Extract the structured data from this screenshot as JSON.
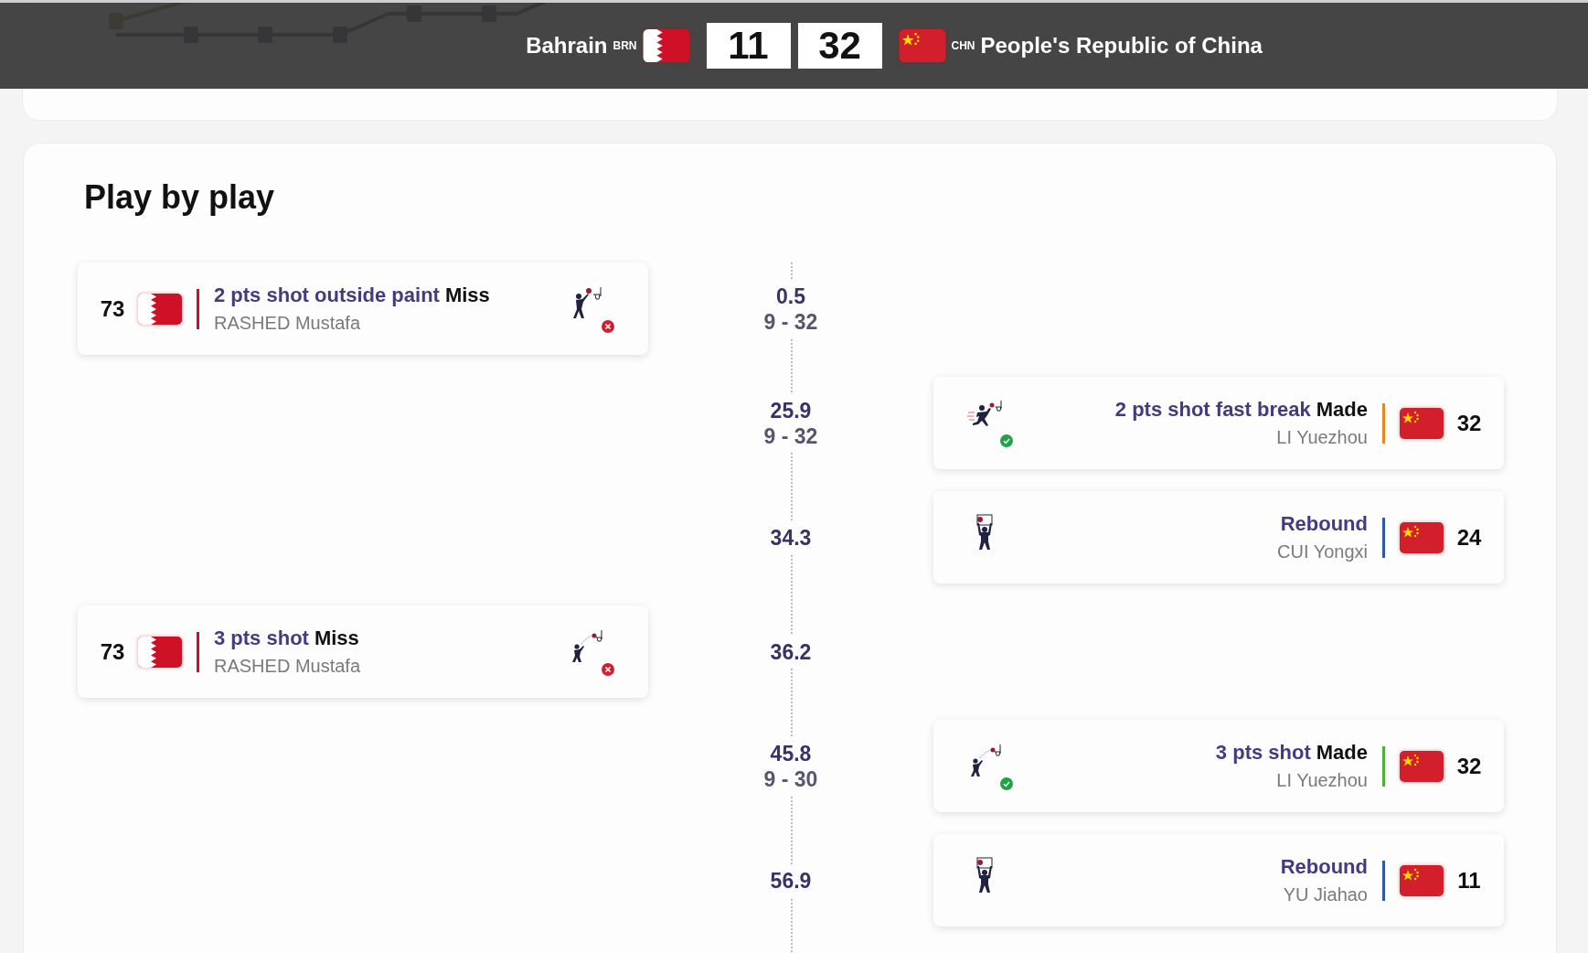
{
  "header": {
    "teams": [
      {
        "name": "Bahrain",
        "code": "BRN",
        "score": "11"
      },
      {
        "name": "People's Republic of China",
        "code": "CHN",
        "score": "32"
      }
    ]
  },
  "play_by_play": {
    "title": "Play by play",
    "events": [
      {
        "time": "0.5",
        "score": "9 - 32",
        "home": {
          "number": "73",
          "color": "#c8102e",
          "action": "2 pts shot outside paint",
          "result": "Miss",
          "player": "RASHED Mustafa",
          "kind": "shot",
          "made": false
        }
      },
      {
        "time": "25.9",
        "score": "9 - 32",
        "away": {
          "number": "32",
          "color": "#e08a1e",
          "action": "2 pts shot fast break",
          "result": "Made",
          "player": "LI Yuezhou",
          "kind": "fastbreak",
          "made": true
        }
      },
      {
        "time": "34.3",
        "away": {
          "number": "24",
          "color": "#2c5aa0",
          "action": "Rebound",
          "player": "CUI Yongxi",
          "kind": "rebound"
        }
      },
      {
        "time": "36.2",
        "home": {
          "number": "73",
          "color": "#c8102e",
          "action": "3 pts shot",
          "result": "Miss",
          "player": "RASHED Mustafa",
          "kind": "three",
          "made": false
        }
      },
      {
        "time": "45.8",
        "score": "9 - 30",
        "away": {
          "number": "32",
          "color": "#4caf3a",
          "action": "3 pts shot",
          "result": "Made",
          "player": "LI Yuezhou",
          "kind": "three",
          "made": true
        }
      },
      {
        "time": "56.9",
        "away": {
          "number": "11",
          "color": "#2c5aa0",
          "action": "Rebound",
          "player": "YU Jiahao",
          "kind": "rebound"
        }
      }
    ]
  }
}
